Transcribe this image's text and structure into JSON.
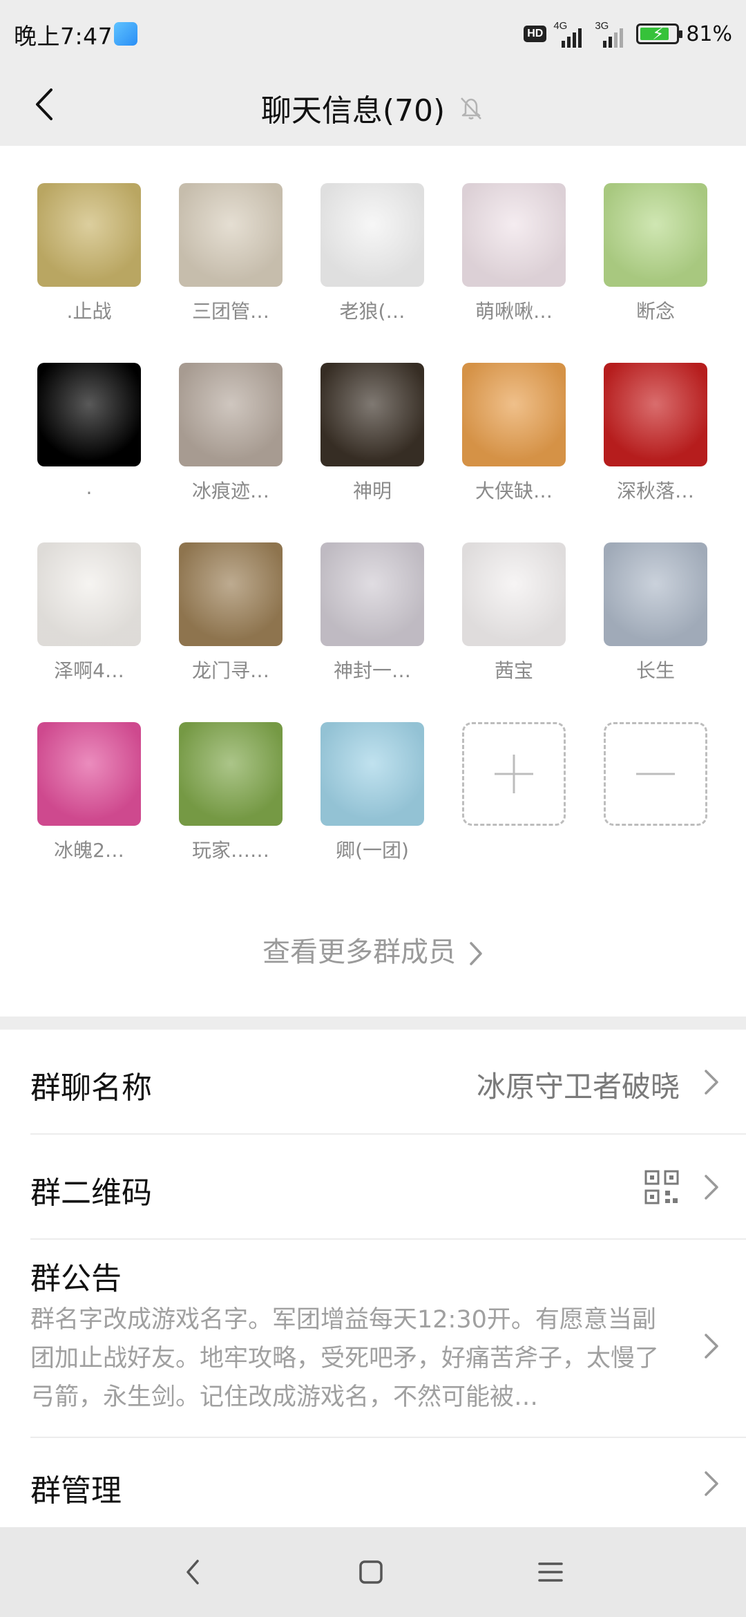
{
  "status_bar": {
    "time": "晚上7:47",
    "hd": "HD",
    "net1": "4G",
    "net2": "3G",
    "battery": "81%",
    "battery_level": 0.81
  },
  "header": {
    "title": "聊天信息(70)",
    "back_icon": "back-arrow-icon",
    "mute_icon": "bell-off-icon"
  },
  "members": [
    {
      "name": ".止战",
      "color": "#c9b46a"
    },
    {
      "name": "三团管…",
      "color": "#d7cdbb"
    },
    {
      "name": "老狼(…",
      "color": "#f2f2f2"
    },
    {
      "name": "萌啾啾…",
      "color": "#efe2e8"
    },
    {
      "name": "断念",
      "color": "#b6d98a"
    },
    {
      "name": ".",
      "color": "#000000"
    },
    {
      "name": "冰痕迹…",
      "color": "#b5a89d"
    },
    {
      "name": "神明",
      "color": "#3b3127"
    },
    {
      "name": "大侠缺…",
      "color": "#e79e4c"
    },
    {
      "name": "深秋落…",
      "color": "#c51f1f"
    },
    {
      "name": "泽啊4…",
      "color": "#f1eeea"
    },
    {
      "name": "龙门寻…",
      "color": "#9a7e55"
    },
    {
      "name": "神封一…",
      "color": "#cfcad2"
    },
    {
      "name": "茜宝",
      "color": "#f2efef"
    },
    {
      "name": "长生",
      "color": "#aeb9c8"
    },
    {
      "name": "冰魄2…",
      "color": "#e04f9a"
    },
    {
      "name": "玩家……",
      "color": "#7fa64a"
    },
    {
      "name": "卿(一团)",
      "color": "#9fd2e6"
    }
  ],
  "add_member_icon": "plus-icon",
  "remove_member_icon": "minus-icon",
  "more_members": "查看更多群成员",
  "settings": {
    "group_name_label": "群聊名称",
    "group_name_value": "冰原守卫者破晓",
    "qr_label": "群二维码",
    "qr_icon": "qr-code-icon",
    "notice_label": "群公告",
    "notice_text": "群名字改成游戏名字。军团增益每天12:30开。有愿意当副团加止战好友。地牢攻略，受死吧矛，好痛苦斧子，太慢了弓箭，永生剑。记住改成游戏名，不然可能被…",
    "manage_label": "群管理"
  },
  "navbar": {
    "back_icon": "nav-back-icon",
    "home_icon": "nav-home-icon",
    "menu_icon": "nav-menu-icon"
  }
}
